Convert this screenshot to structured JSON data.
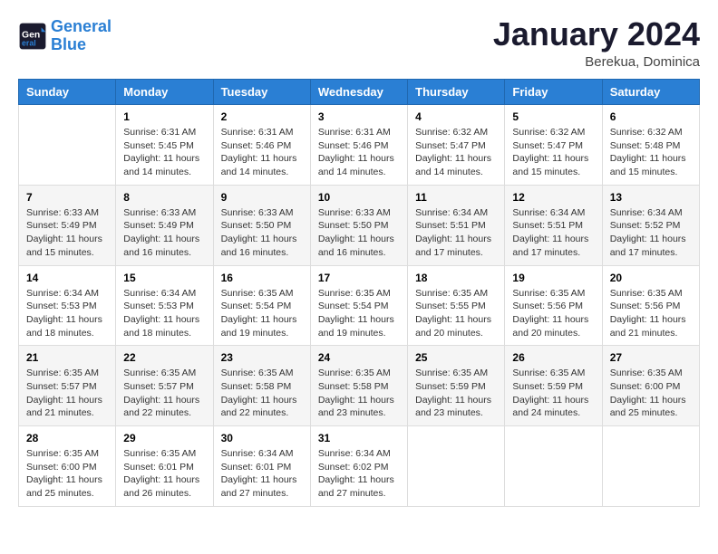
{
  "header": {
    "logo_line1": "General",
    "logo_line2": "Blue",
    "month": "January 2024",
    "location": "Berekua, Dominica"
  },
  "weekdays": [
    "Sunday",
    "Monday",
    "Tuesday",
    "Wednesday",
    "Thursday",
    "Friday",
    "Saturday"
  ],
  "rows": [
    [
      {
        "date": "",
        "info": ""
      },
      {
        "date": "1",
        "info": "Sunrise: 6:31 AM\nSunset: 5:45 PM\nDaylight: 11 hours\nand 14 minutes."
      },
      {
        "date": "2",
        "info": "Sunrise: 6:31 AM\nSunset: 5:46 PM\nDaylight: 11 hours\nand 14 minutes."
      },
      {
        "date": "3",
        "info": "Sunrise: 6:31 AM\nSunset: 5:46 PM\nDaylight: 11 hours\nand 14 minutes."
      },
      {
        "date": "4",
        "info": "Sunrise: 6:32 AM\nSunset: 5:47 PM\nDaylight: 11 hours\nand 14 minutes."
      },
      {
        "date": "5",
        "info": "Sunrise: 6:32 AM\nSunset: 5:47 PM\nDaylight: 11 hours\nand 15 minutes."
      },
      {
        "date": "6",
        "info": "Sunrise: 6:32 AM\nSunset: 5:48 PM\nDaylight: 11 hours\nand 15 minutes."
      }
    ],
    [
      {
        "date": "7",
        "info": "Sunrise: 6:33 AM\nSunset: 5:49 PM\nDaylight: 11 hours\nand 15 minutes."
      },
      {
        "date": "8",
        "info": "Sunrise: 6:33 AM\nSunset: 5:49 PM\nDaylight: 11 hours\nand 16 minutes."
      },
      {
        "date": "9",
        "info": "Sunrise: 6:33 AM\nSunset: 5:50 PM\nDaylight: 11 hours\nand 16 minutes."
      },
      {
        "date": "10",
        "info": "Sunrise: 6:33 AM\nSunset: 5:50 PM\nDaylight: 11 hours\nand 16 minutes."
      },
      {
        "date": "11",
        "info": "Sunrise: 6:34 AM\nSunset: 5:51 PM\nDaylight: 11 hours\nand 17 minutes."
      },
      {
        "date": "12",
        "info": "Sunrise: 6:34 AM\nSunset: 5:51 PM\nDaylight: 11 hours\nand 17 minutes."
      },
      {
        "date": "13",
        "info": "Sunrise: 6:34 AM\nSunset: 5:52 PM\nDaylight: 11 hours\nand 17 minutes."
      }
    ],
    [
      {
        "date": "14",
        "info": "Sunrise: 6:34 AM\nSunset: 5:53 PM\nDaylight: 11 hours\nand 18 minutes."
      },
      {
        "date": "15",
        "info": "Sunrise: 6:34 AM\nSunset: 5:53 PM\nDaylight: 11 hours\nand 18 minutes."
      },
      {
        "date": "16",
        "info": "Sunrise: 6:35 AM\nSunset: 5:54 PM\nDaylight: 11 hours\nand 19 minutes."
      },
      {
        "date": "17",
        "info": "Sunrise: 6:35 AM\nSunset: 5:54 PM\nDaylight: 11 hours\nand 19 minutes."
      },
      {
        "date": "18",
        "info": "Sunrise: 6:35 AM\nSunset: 5:55 PM\nDaylight: 11 hours\nand 20 minutes."
      },
      {
        "date": "19",
        "info": "Sunrise: 6:35 AM\nSunset: 5:56 PM\nDaylight: 11 hours\nand 20 minutes."
      },
      {
        "date": "20",
        "info": "Sunrise: 6:35 AM\nSunset: 5:56 PM\nDaylight: 11 hours\nand 21 minutes."
      }
    ],
    [
      {
        "date": "21",
        "info": "Sunrise: 6:35 AM\nSunset: 5:57 PM\nDaylight: 11 hours\nand 21 minutes."
      },
      {
        "date": "22",
        "info": "Sunrise: 6:35 AM\nSunset: 5:57 PM\nDaylight: 11 hours\nand 22 minutes."
      },
      {
        "date": "23",
        "info": "Sunrise: 6:35 AM\nSunset: 5:58 PM\nDaylight: 11 hours\nand 22 minutes."
      },
      {
        "date": "24",
        "info": "Sunrise: 6:35 AM\nSunset: 5:58 PM\nDaylight: 11 hours\nand 23 minutes."
      },
      {
        "date": "25",
        "info": "Sunrise: 6:35 AM\nSunset: 5:59 PM\nDaylight: 11 hours\nand 23 minutes."
      },
      {
        "date": "26",
        "info": "Sunrise: 6:35 AM\nSunset: 5:59 PM\nDaylight: 11 hours\nand 24 minutes."
      },
      {
        "date": "27",
        "info": "Sunrise: 6:35 AM\nSunset: 6:00 PM\nDaylight: 11 hours\nand 25 minutes."
      }
    ],
    [
      {
        "date": "28",
        "info": "Sunrise: 6:35 AM\nSunset: 6:00 PM\nDaylight: 11 hours\nand 25 minutes."
      },
      {
        "date": "29",
        "info": "Sunrise: 6:35 AM\nSunset: 6:01 PM\nDaylight: 11 hours\nand 26 minutes."
      },
      {
        "date": "30",
        "info": "Sunrise: 6:34 AM\nSunset: 6:01 PM\nDaylight: 11 hours\nand 27 minutes."
      },
      {
        "date": "31",
        "info": "Sunrise: 6:34 AM\nSunset: 6:02 PM\nDaylight: 11 hours\nand 27 minutes."
      },
      {
        "date": "",
        "info": ""
      },
      {
        "date": "",
        "info": ""
      },
      {
        "date": "",
        "info": ""
      }
    ]
  ]
}
